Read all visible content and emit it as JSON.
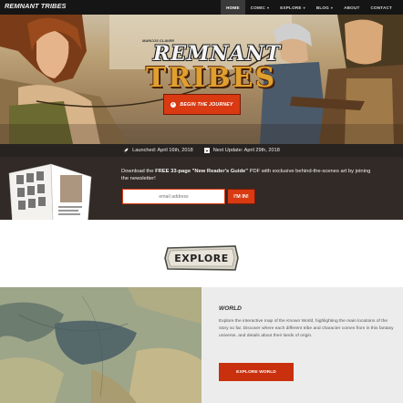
{
  "nav": {
    "brand": "REMNANT TRIBES",
    "items": [
      {
        "label": "HOME",
        "active": true,
        "dropdown": false
      },
      {
        "label": "COMIC",
        "active": false,
        "dropdown": true
      },
      {
        "label": "EXPLORE",
        "active": false,
        "dropdown": true
      },
      {
        "label": "BLOG",
        "active": false,
        "dropdown": true
      },
      {
        "label": "ABOUT",
        "active": false,
        "dropdown": false
      },
      {
        "label": "CONTACT",
        "active": false,
        "dropdown": false
      }
    ]
  },
  "hero": {
    "logo_top": "MARCOS CLAVER",
    "logo_main": "REMNANT",
    "logo_sub": "TRIBES",
    "cta_label": "BEGIN THE JOURNEY"
  },
  "launch": {
    "launched": "Launched: April 16th, 2018",
    "next_update": "Next Update: April 29th, 2018"
  },
  "newsletter": {
    "text_before": "Download the ",
    "text_bold": "FREE 33-page \"New Reader's Guide\"",
    "text_after": " PDF with exclusive behind-the-scenes art by joining the newsletter!",
    "email_placeholder": "email address",
    "submit_label": "I'M IN!"
  },
  "explore": {
    "badge_label": "EXPLORE"
  },
  "world": {
    "title": "WORLD",
    "description": "Explore the interactive map of the Known World, highlighting the main locations of the story so far. Discover where each different tribe and character comes from in this fantasy universe, and details about their lands of origin.",
    "button_label": "EXPLORE WORLD"
  },
  "colors": {
    "accent": "#d93a12",
    "nav_bg": "#151515",
    "dark_band": "#312a26"
  }
}
